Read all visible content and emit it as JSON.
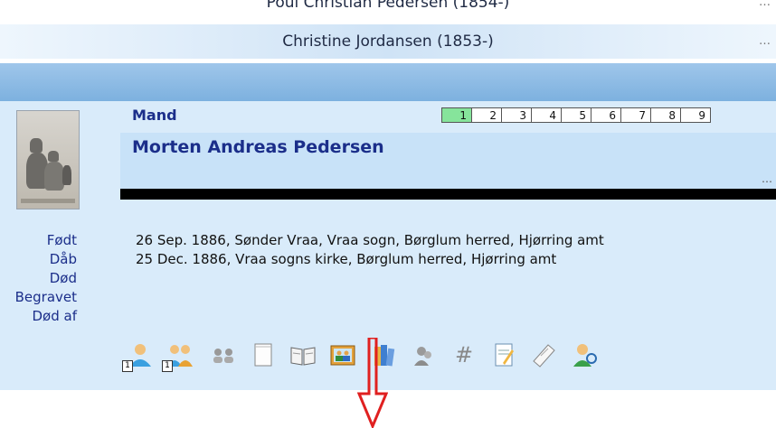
{
  "parents": {
    "top": "Poul Christian Pedersen (1854-)",
    "bottom": "Christine Jordansen (1853-)"
  },
  "person": {
    "role": "Mand",
    "name": "Morten Andreas Pedersen",
    "tabs": [
      "1",
      "2",
      "3",
      "4",
      "5",
      "6",
      "7",
      "8",
      "9"
    ],
    "active_tab": "1"
  },
  "events": [
    {
      "label": "Født",
      "value": "26 Sep. 1886, Sønder Vraa, Vraa sogn, Børglum herred, Hjørring amt"
    },
    {
      "label": "Dåb",
      "value": "25 Dec. 1886, Vraa sogns kirke, Børglum herred, Hjørring amt"
    },
    {
      "label": "Død",
      "value": ""
    },
    {
      "label": "Begravet",
      "value": ""
    },
    {
      "label": "Død af",
      "value": ""
    }
  ],
  "toolbar": {
    "badge": "1",
    "icons": [
      "person-icon",
      "family-icon",
      "persons-gray-icon",
      "notepad-icon",
      "open-book-icon",
      "photo-icon",
      "books-icon",
      "people-gray-icon",
      "hash-icon",
      "document-icon",
      "paper-icon",
      "person-search-icon"
    ]
  },
  "colors": {
    "accent": "#1b2e8a",
    "active_tab": "#86e49b",
    "panel": "#d9ebfa",
    "arrow": "#e02020"
  }
}
